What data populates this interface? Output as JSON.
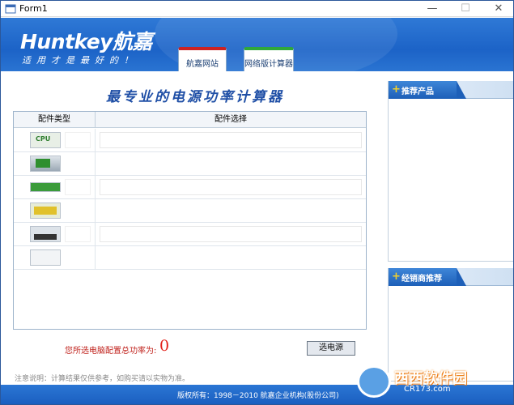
{
  "window": {
    "title": "Form1",
    "minimize": "—",
    "maximize": "☐",
    "close": "✕"
  },
  "banner": {
    "logo": "Huntkey航嘉",
    "slogan": "适用才是最好的！"
  },
  "tabs": [
    {
      "label": "航嘉网站"
    },
    {
      "label": "网络版计算器"
    }
  ],
  "main": {
    "title": "最专业的电源功率计算器",
    "columns": [
      "配件类型",
      "配件选择"
    ],
    "rows": [
      {
        "component": "cpu-image"
      },
      {
        "component": "motherboard-image"
      },
      {
        "component": "memory-image"
      },
      {
        "component": "graphics-card-image"
      },
      {
        "component": "hard-drive-image"
      },
      {
        "component": "optical-drive-image"
      }
    ],
    "total_label": "您所选电脑配置总功率为:",
    "total_value": "0",
    "pick_button": "选电源",
    "note": "注意说明：计算结果仅供参考，如购买请以实物为准。"
  },
  "panels": {
    "recommend": "推荐产品",
    "dealer": "经销商推荐"
  },
  "footer": {
    "copyright": "版权所有：1998－2010    航嘉企业机构(股份公司)"
  },
  "watermark": {
    "name": "西西软件园",
    "site": "CR173.com"
  }
}
